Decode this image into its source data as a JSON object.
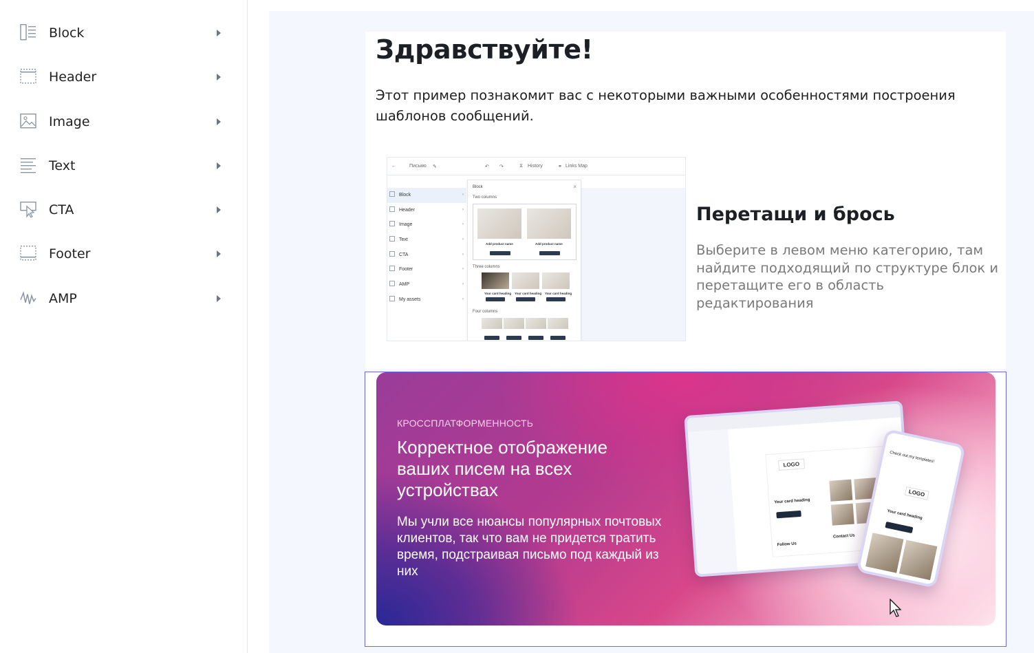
{
  "sidebar": {
    "items": [
      {
        "label": "Block",
        "icon": "block-icon"
      },
      {
        "label": "Header",
        "icon": "header-icon"
      },
      {
        "label": "Image",
        "icon": "image-icon"
      },
      {
        "label": "Text",
        "icon": "text-icon"
      },
      {
        "label": "CTA",
        "icon": "cta-icon"
      },
      {
        "label": "Footer",
        "icon": "footer-icon"
      },
      {
        "label": "AMP",
        "icon": "amp-icon"
      }
    ]
  },
  "letter": {
    "title": "Здравствуйте!",
    "intro": "Этот пример познакомит вас с некоторыми важными особенностями построения шаблонов сообщений.",
    "dragdrop_title": "Перетащи и брось",
    "dragdrop_text": "Выберите в левом меню категорию, там найдите подходящий по структуре блок и перетащите его в область редактирования"
  },
  "mock": {
    "doc_name": "Письмо",
    "history": "History",
    "links_map": "Links Map",
    "panel_title": "Block",
    "two_columns": "Two columns",
    "three_columns": "Three columns",
    "four_columns": "Four columns",
    "product_name": "Add product name",
    "card_heading": "Your card heading",
    "menu": [
      "Block",
      "Header",
      "Image",
      "Text",
      "CTA",
      "Footer",
      "AMP",
      "My assets"
    ]
  },
  "banner": {
    "kicker": "КРОССПЛАТФОРМЕННОСТЬ",
    "title": "Корректное отображение ваших писем на всех устройствах",
    "text": "Мы учли все нюансы популярных почтовых клиентов, так что вам не придется тратить время, подстраивая письмо под каждый из них",
    "laptop_logo": "LOGO",
    "laptop_card": "Your card heading",
    "laptop_follow": "Follow Us",
    "laptop_contact": "Contact Us",
    "phone_logo": "LOGO",
    "phone_card": "Your card heading",
    "phone_subject": "Check out my templates!"
  },
  "colors": {
    "selection_border": "#6b6ae0",
    "canvas_bg": "#f4f7fd",
    "banner_pink": "#d8478a",
    "banner_blue": "#282896"
  }
}
